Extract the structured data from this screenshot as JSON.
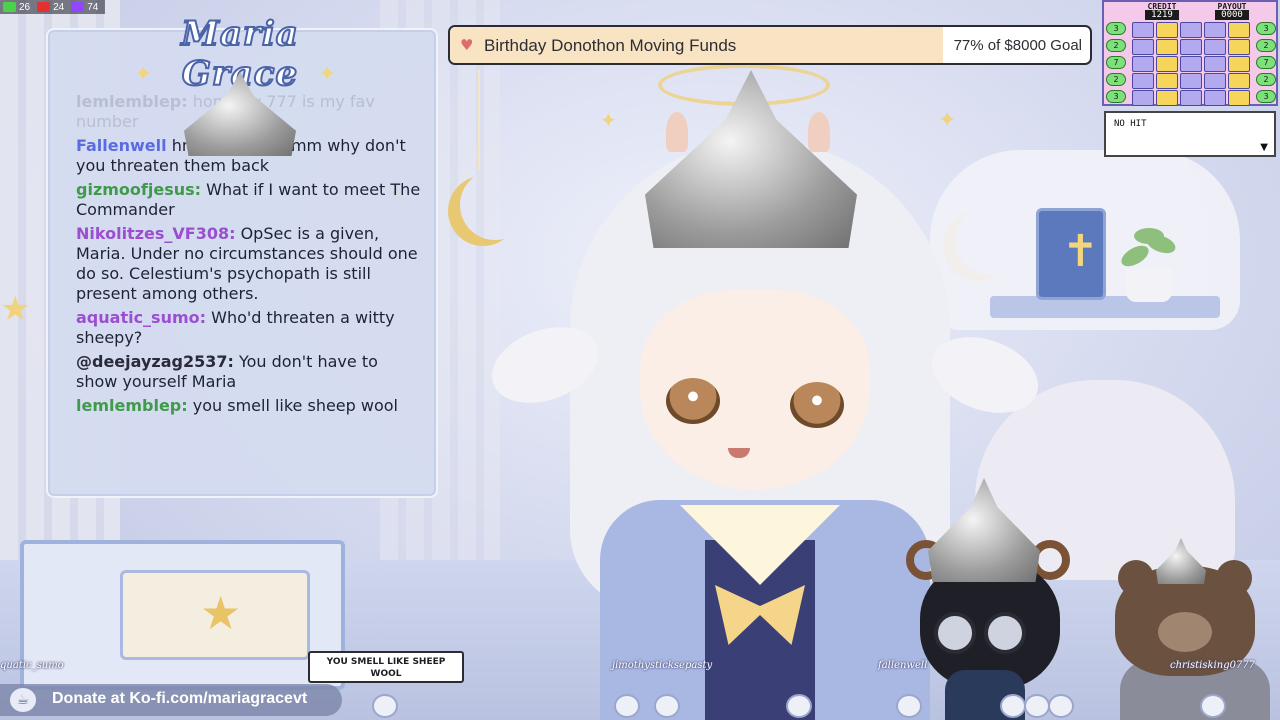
{
  "stats": [
    {
      "icon": "kick-icon",
      "count": "26",
      "color": "#4ad24a"
    },
    {
      "icon": "youtube-icon",
      "count": "24",
      "color": "#e53030"
    },
    {
      "icon": "twitch-icon",
      "count": "74",
      "color": "#9146ff"
    }
  ],
  "brand": {
    "logo_text": "Maria Grace"
  },
  "goal": {
    "title": "Birthday Donothon Moving Funds",
    "status": "77% of $8000 Goal",
    "percent": 77,
    "fill_color": "#f8e4c2"
  },
  "chat": {
    "messages": [
      {
        "user": "lemlemblep:",
        "text": "honestly 777 is my fav number",
        "user_color": "#b8bed4",
        "faded": true
      },
      {
        "user": "Fallenwell",
        "text": "hmmmmmmmmm why don't you threaten them back",
        "user_color": "#5b6ce0",
        "faded": false
      },
      {
        "user": "gizmoofjesus:",
        "text": "What if I want to meet The Commander",
        "user_color": "#3f9a4a",
        "faded": false
      },
      {
        "user": "Nikolitzes_VF308:",
        "text": "OpSec is a given, Maria. Under no circumstances should one do so. Celestium's psychopath is still present among others.",
        "user_color": "#9b4fd0",
        "faded": false
      },
      {
        "user": "aquatic_sumo:",
        "text": "Who'd threaten a witty sheepy?",
        "user_color": "#9b4fd0",
        "faded": false
      },
      {
        "user": "@deejayzag2537:",
        "text": "You don't have to show yourself Maria",
        "user_color": "#2a2a38",
        "faded": false
      },
      {
        "user": "lemlemblep:",
        "text": "you smell like sheep wool",
        "user_color": "#3f9a4a",
        "faded": false
      }
    ]
  },
  "slot": {
    "credit_label": "CREDIT",
    "credit_value": "1219",
    "payout_label": "PAYOUT",
    "payout_value": "0000",
    "row_markers": [
      "3",
      "2",
      "7",
      "2",
      "3"
    ],
    "result": "NO HIT"
  },
  "donate": {
    "text": "Donate at Ko-fi.com/mariagracevt",
    "icon": "kofi-cup-icon"
  },
  "speech_bubble": "YOU SMELL LIKE SHEEP WOOL",
  "viewers": [
    "quatic_sumo",
    "jimothysticksepasty",
    "fallenwell",
    "christisking0777"
  ]
}
